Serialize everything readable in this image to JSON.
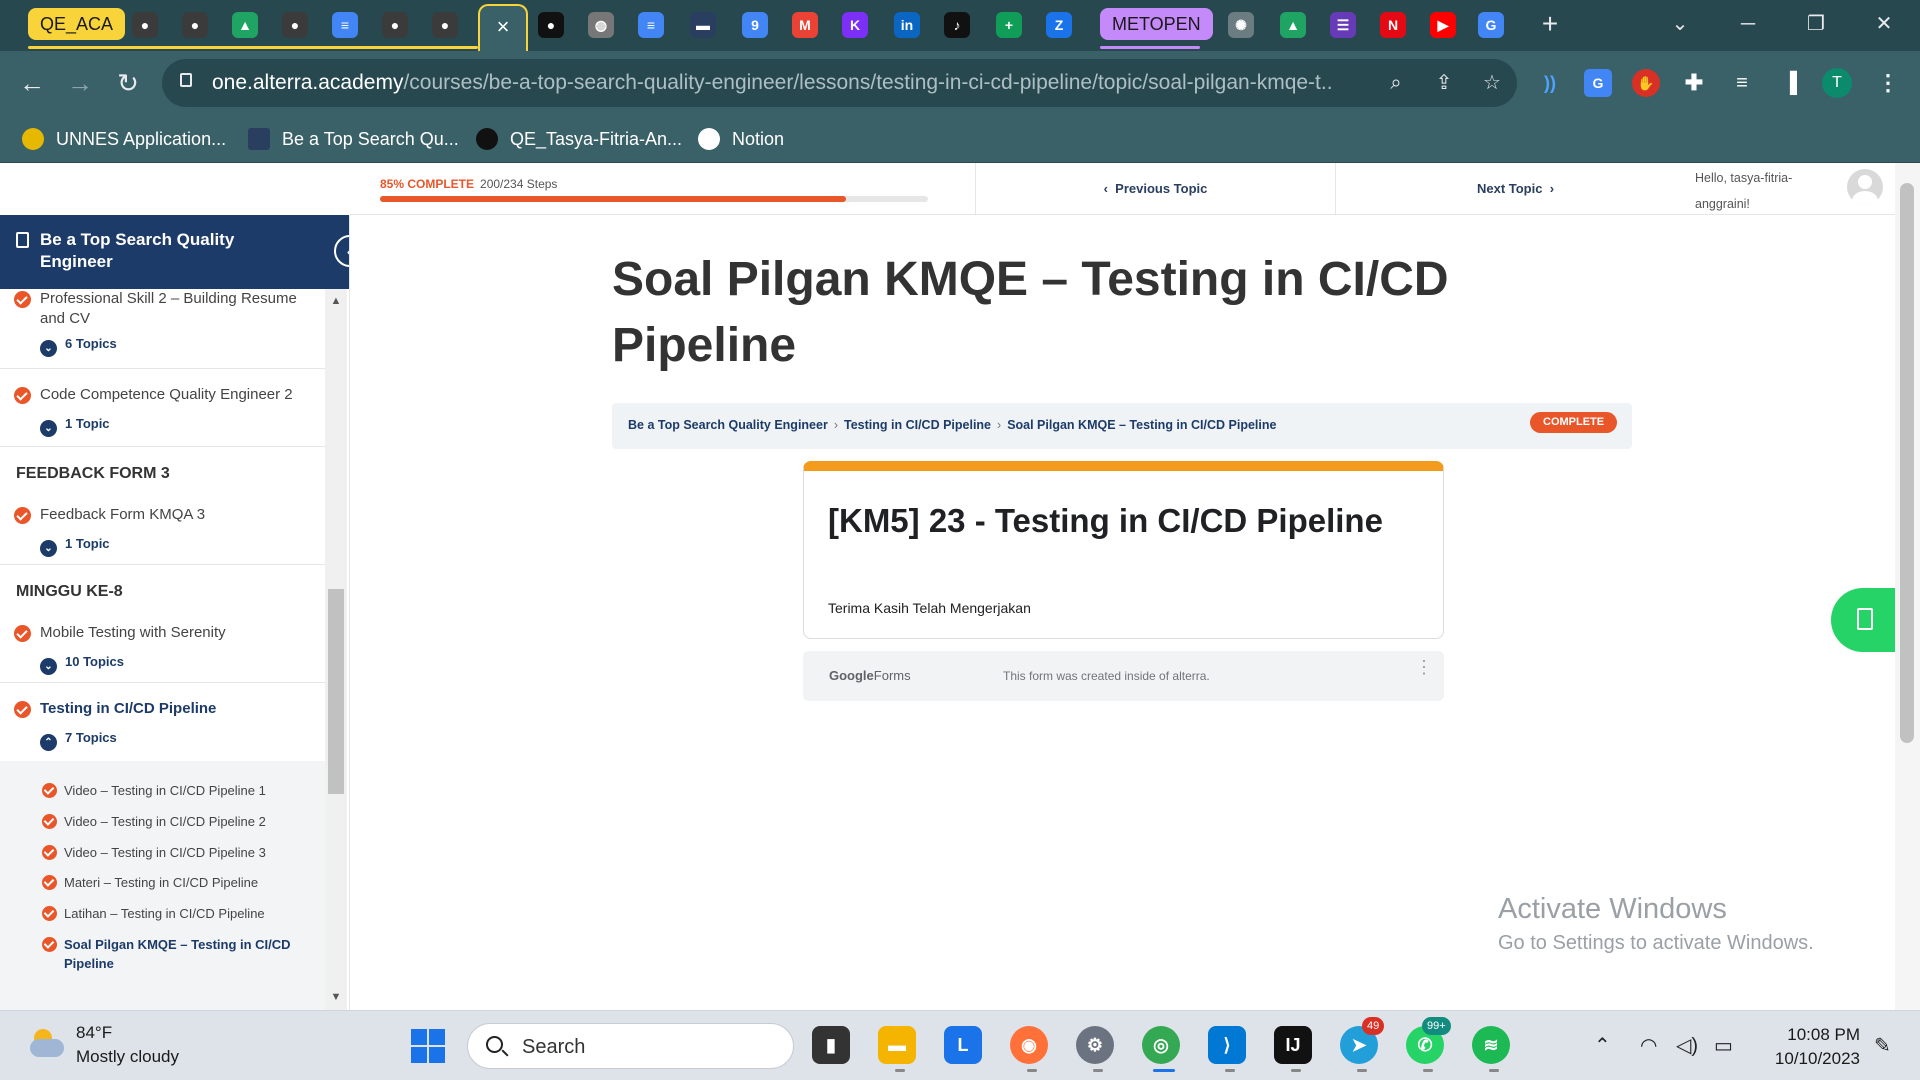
{
  "browser": {
    "tab_group_1": "QE_ACA",
    "tab_group_2": "METOPEN",
    "active_tab_close": "×",
    "new_tab": "+",
    "url_host": "one.alterra.academy",
    "url_path": "/courses/be-a-top-search-quality-engineer/lessons/testing-in-ci-cd-pipeline/topic/soal-pilgan-kmqe-t...",
    "profile_initial": "T",
    "bookmarks": [
      {
        "label": "UNNES Application..."
      },
      {
        "label": "Be a Top Search Qu..."
      },
      {
        "label": "QE_Tasya-Fitria-An..."
      },
      {
        "label": "Notion"
      }
    ]
  },
  "lesson_bar": {
    "progress_percent_label": "85% COMPLETE",
    "progress_steps": "200/234 Steps",
    "progress_fraction": 0.85,
    "previous_label": "Previous Topic",
    "next_label": "Next Topic",
    "greeting": "Hello, tasya-fitria-anggraini!"
  },
  "sidebar": {
    "course_title": "Be a Top Search Quality Engineer",
    "items": [
      {
        "title": "Professional Skill 2 – Building Resume and CV",
        "topics": "6 Topics"
      },
      {
        "title": "Code Competence Quality Engineer 2",
        "topics": "1 Topic"
      },
      {
        "section": "FEEDBACK FORM 3"
      },
      {
        "title": "Feedback Form KMQA 3",
        "topics": "1 Topic"
      },
      {
        "section": "MINGGU KE-8"
      },
      {
        "title": "Mobile Testing with Serenity",
        "topics": "10 Topics"
      },
      {
        "title": "Testing in CI/CD Pipeline",
        "topics": "7 Topics"
      }
    ],
    "sub_items": [
      "Video – Testing in CI/CD Pipeline 1",
      "Video – Testing in CI/CD Pipeline 2",
      "Video – Testing in CI/CD Pipeline 3",
      "Materi – Testing in CI/CD Pipeline",
      "Latihan – Testing in CI/CD Pipeline",
      "Soal Pilgan KMQE – Testing in CI/CD Pipeline"
    ]
  },
  "main": {
    "title": "Soal Pilgan KMQE – Testing in CI/CD Pipeline",
    "breadcrumbs": [
      "Be a Top Search Quality Engineer",
      "Testing in CI/CD Pipeline",
      "Soal Pilgan KMQE – Testing in CI/CD Pipeline"
    ],
    "breadcrumb_sep": "›",
    "status_badge": "COMPLETE",
    "form": {
      "title": "[KM5] 23 - Testing in CI/CD Pipeline",
      "confirmation": "Terima Kasih Telah Mengerjakan",
      "brand_google": "Google",
      "brand_forms": "Forms",
      "footer_note": "This form was created inside of alterra."
    }
  },
  "watermark": {
    "line1": "Activate Windows",
    "line2": "Go to Settings to activate Windows."
  },
  "taskbar": {
    "temperature": "84°F",
    "condition": "Mostly cloudy",
    "search_placeholder": "Search",
    "telegram_badge": "49",
    "whatsapp_badge": "99+",
    "time": "10:08 PM",
    "date": "10/10/2023"
  },
  "colors": {
    "accent_orange": "#e8562a",
    "course_navy": "#1d3b68",
    "chrome_dark": "#27484f",
    "chrome_toolbar": "#3a6068",
    "form_accent": "#f39b1c"
  }
}
